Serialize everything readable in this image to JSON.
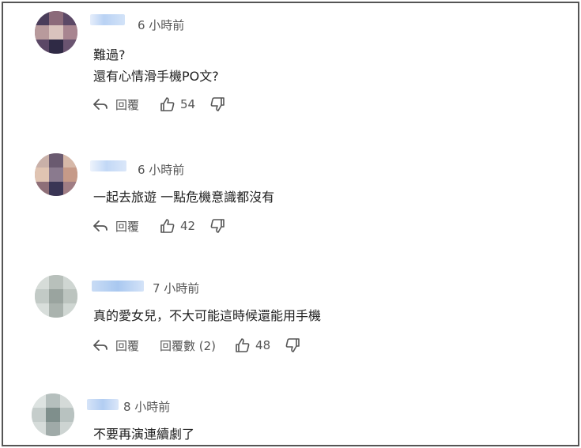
{
  "comments": [
    {
      "time": "6 小時前",
      "lines": [
        "難過?",
        "還有心情滑手機PO文?"
      ],
      "reply_label": "回覆",
      "likes": "54"
    },
    {
      "time": "6 小時前",
      "lines": [
        "一起去旅遊 一點危機意識都沒有"
      ],
      "reply_label": "回覆",
      "likes": "42"
    },
    {
      "time": "7 小時前",
      "lines": [
        "真的愛女兒，不大可能這時候還能用手機"
      ],
      "reply_label": "回覆",
      "replies_label": "回覆數 (2)",
      "likes": "48"
    },
    {
      "time": "8 小時前",
      "lines": [
        "不要再演連續劇了"
      ]
    }
  ],
  "icons": {
    "reply": "reply-arrow-icon",
    "like": "thumbs-up-icon",
    "dislike": "thumbs-down-icon"
  },
  "colors": {
    "text": "#1f1f1f",
    "meta": "#555555",
    "username_blur": "#c9dcf5"
  }
}
